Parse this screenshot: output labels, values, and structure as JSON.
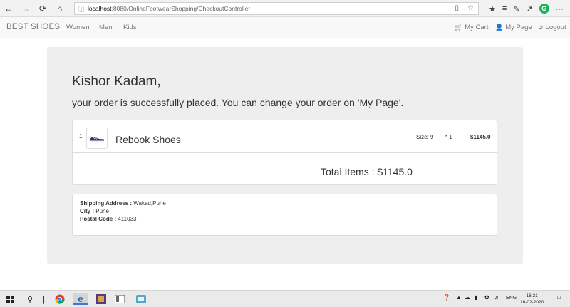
{
  "browser": {
    "url_host": "localhost",
    "url_path": ":8080/OnlineFootwearShopping/CheckoutController",
    "grammarly_label": "G"
  },
  "navbar": {
    "brand": "BEST SHOES",
    "links": [
      "Women",
      "Men",
      "Kids"
    ],
    "right": [
      "My Cart",
      "My Page",
      "Logout"
    ]
  },
  "confirmation": {
    "greeting": "Kishor Kadam,",
    "message": "your order is successfully placed. You can change your order on 'My Page'."
  },
  "order": {
    "items": [
      {
        "index": "1",
        "name": "Rebook Shoes",
        "size": "Size: 9",
        "qty": "* 1",
        "price": "$1145.0"
      }
    ],
    "total": "Total Items : $1145.0"
  },
  "shipping": {
    "address_label": "Shipping Address :",
    "address_value": "Wakad,Pune",
    "city_label": "City :",
    "city_value": "Pune",
    "postal_label": "Postal Code :",
    "postal_value": "411033"
  },
  "taskbar": {
    "lang": "ENG",
    "time": "16:21",
    "date": "16-02-2020"
  },
  "colors": {
    "jumbotron": "#eeeeee",
    "navbar": "#f8f8f8",
    "panel_border": "#dddddd"
  }
}
